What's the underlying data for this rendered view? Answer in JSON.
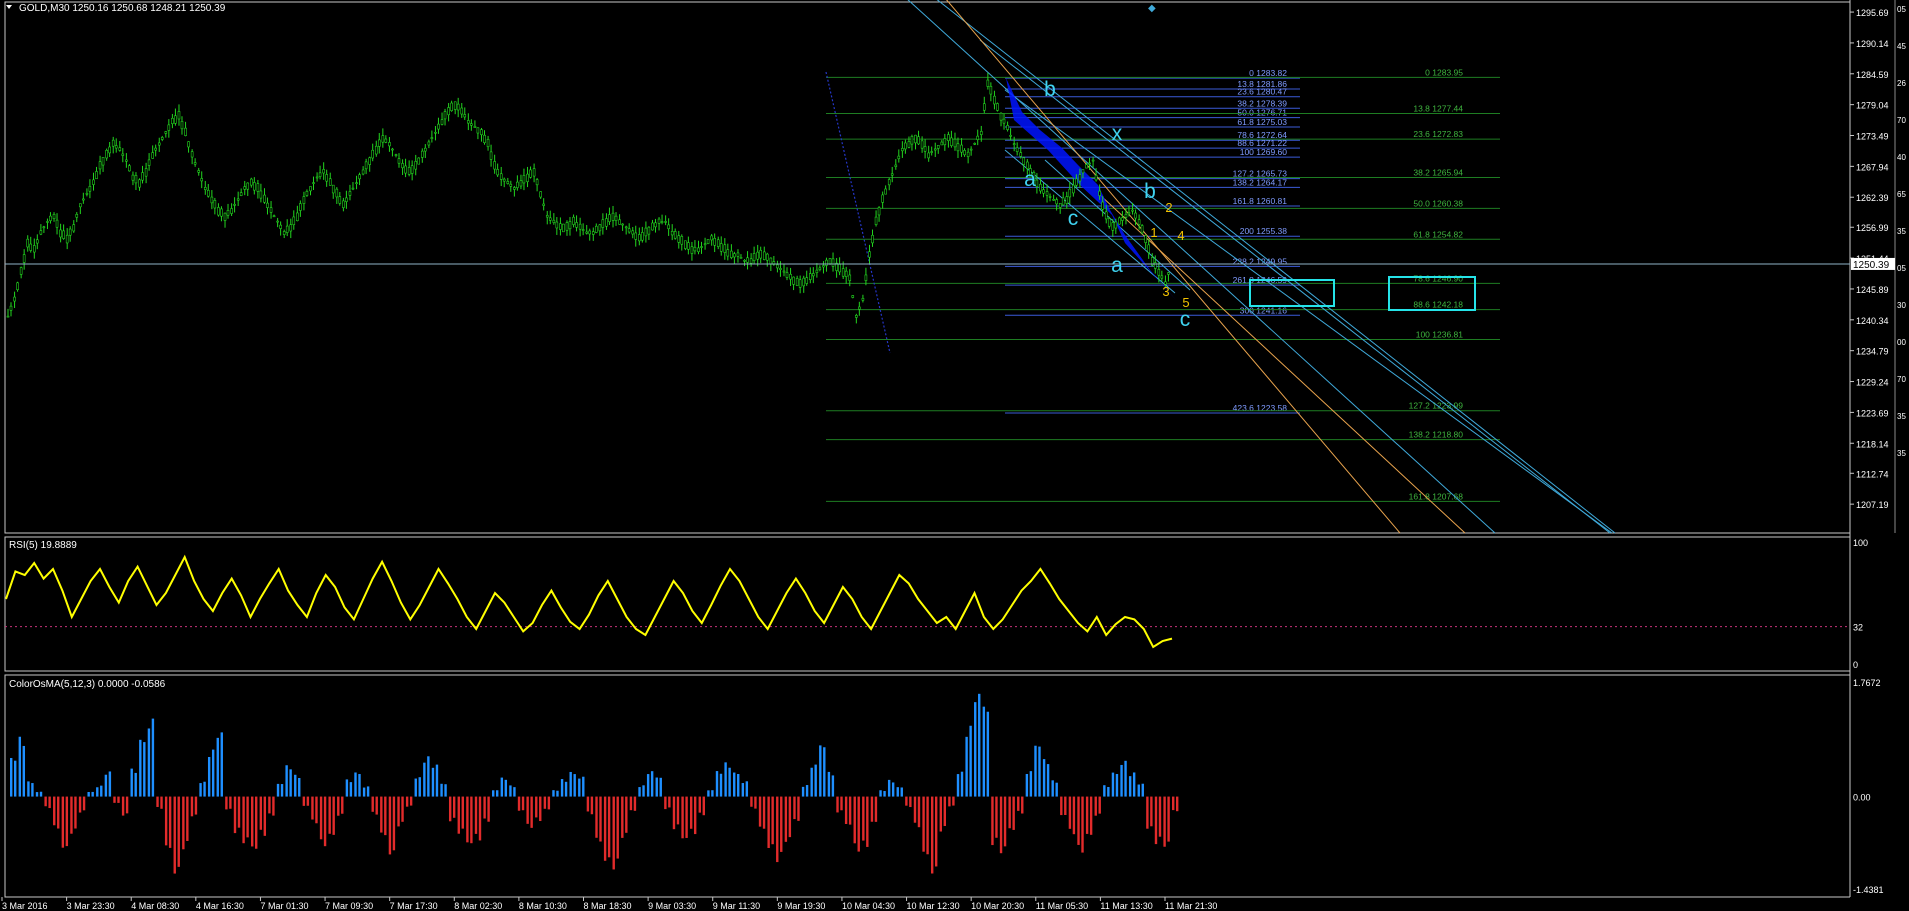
{
  "main": {
    "header": "GOLD,M30  1250.16 1250.68 1248.21 1250.39",
    "ylim": [
      1202.0,
      1297.5
    ],
    "yticks": [
      "1295.69",
      "1290.14",
      "1284.59",
      "1279.04",
      "1273.49",
      "1267.94",
      "1262.39",
      "1256.99",
      "1251.44",
      "1245.89",
      "1240.34",
      "1234.79",
      "1229.24",
      "1223.69",
      "1218.14",
      "1212.74",
      "1207.19"
    ],
    "current_price": "1250.39",
    "close_series": [
      1241,
      1244,
      1249,
      1254,
      1253,
      1256,
      1258,
      1259,
      1256,
      1255,
      1257,
      1261,
      1263,
      1265,
      1268,
      1270,
      1272,
      1271,
      1269,
      1266,
      1265,
      1267,
      1270,
      1272,
      1274,
      1276,
      1277,
      1274,
      1270,
      1267,
      1264,
      1262,
      1260,
      1259,
      1260,
      1262,
      1264,
      1265,
      1264,
      1262,
      1260,
      1258,
      1256,
      1257,
      1259,
      1262,
      1264,
      1266,
      1267,
      1265,
      1263,
      1261,
      1263,
      1265,
      1267,
      1269,
      1271,
      1273,
      1272,
      1270,
      1268,
      1267,
      1268,
      1270,
      1272,
      1274,
      1276,
      1278,
      1279,
      1278,
      1276,
      1275,
      1274,
      1272,
      1268,
      1266,
      1265,
      1264,
      1265,
      1266,
      1267,
      1263,
      1259,
      1258,
      1257,
      1257,
      1258,
      1257,
      1256,
      1256,
      1257,
      1258,
      1259,
      1258,
      1257,
      1256,
      1255,
      1256,
      1257,
      1258,
      1258,
      1256,
      1255,
      1254,
      1253,
      1253,
      1254,
      1255,
      1254,
      1253,
      1252,
      1252,
      1251,
      1251,
      1252,
      1252,
      1251,
      1250,
      1249,
      1248,
      1247,
      1247,
      1248,
      1249,
      1250,
      1251,
      1250,
      1249,
      1248,
      1241,
      1244,
      1252,
      1258,
      1262,
      1265,
      1268,
      1271,
      1272,
      1273,
      1272,
      1270,
      1271,
      1272,
      1273,
      1272,
      1271,
      1270,
      1272,
      1274,
      1283,
      1280,
      1277,
      1275,
      1272,
      1270,
      1268,
      1266,
      1264,
      1263,
      1262,
      1261,
      1262,
      1264,
      1266,
      1268,
      1269,
      1263,
      1259,
      1257,
      1258,
      1259,
      1260,
      1258,
      1255,
      1251,
      1249,
      1247,
      1250.39
    ],
    "fib_left": [
      {
        "label": "0 1283.82",
        "price": 1283.82
      },
      {
        "label": "13.8 1281.86",
        "price": 1281.86
      },
      {
        "label": "23.6 1280.47",
        "price": 1280.47
      },
      {
        "label": "38.2 1278.39",
        "price": 1278.39
      },
      {
        "label": "50.0 1276.71",
        "price": 1276.71
      },
      {
        "label": "61.8 1275.03",
        "price": 1275.03
      },
      {
        "label": "78.6 1272.64",
        "price": 1272.64
      },
      {
        "label": "88.6 1271.22",
        "price": 1271.22
      },
      {
        "label": "100 1269.60",
        "price": 1269.6
      },
      {
        "label": "127.2 1265.73",
        "price": 1265.73
      },
      {
        "label": "138.2 1264.17",
        "price": 1264.17
      },
      {
        "label": "161.8 1260.81",
        "price": 1260.81
      },
      {
        "label": "200 1255.38",
        "price": 1255.38
      },
      {
        "label": "238.2 1249.95",
        "price": 1249.95
      },
      {
        "label": "261.8 1246.59",
        "price": 1246.59
      },
      {
        "label": "300 1241.16",
        "price": 1241.16
      },
      {
        "label": "423.6 1223.58",
        "price": 1223.58
      }
    ],
    "fib_right": [
      {
        "label": "0 1283.95",
        "price": 1283.95
      },
      {
        "label": "13.8 1277.44",
        "price": 1277.44
      },
      {
        "label": "23.6 1272.83",
        "price": 1272.83
      },
      {
        "label": "38.2 1265.94",
        "price": 1265.94
      },
      {
        "label": "50.0 1260.38",
        "price": 1260.38
      },
      {
        "label": "61.8 1254.82",
        "price": 1254.82
      },
      {
        "label": "78.6 1246.90",
        "price": 1246.9
      },
      {
        "label": "88.6 1242.18",
        "price": 1242.18
      },
      {
        "label": "100 1236.81",
        "price": 1236.81
      },
      {
        "label": "127.2 1223.99",
        "price": 1223.99
      },
      {
        "label": "138.2 1218.80",
        "price": 1218.8
      },
      {
        "label": "161.8 1207.68",
        "price": 1207.68
      }
    ],
    "wave_labels": [
      {
        "text": "b",
        "color": "#3fd3f0"
      },
      {
        "text": "x",
        "color": "#3fd3f0"
      },
      {
        "text": "a",
        "color": "#3fd3f0"
      },
      {
        "text": "c",
        "color": "#3fd3f0"
      },
      {
        "text": "b",
        "color": "#3fd3f0"
      },
      {
        "text": "a",
        "color": "#3fd3f0"
      },
      {
        "text": "c",
        "color": "#3fd3f0"
      },
      {
        "text": "1",
        "color": "#f2c200"
      },
      {
        "text": "2",
        "color": "#f2c200"
      },
      {
        "text": "3",
        "color": "#f2c200"
      },
      {
        "text": "4",
        "color": "#f2c200"
      },
      {
        "text": "5",
        "color": "#f2c200"
      }
    ],
    "target_boxes": [
      {
        "price": 1246.59,
        "color": "#25e3e8"
      },
      {
        "price": 1246.9,
        "color": "#25e3e8"
      }
    ],
    "right_edge_marks": [
      "05",
      "45",
      "26",
      "70",
      "40",
      "65",
      "35",
      "05",
      "30",
      "00",
      "70",
      "35",
      "35"
    ]
  },
  "rsi": {
    "header": "RSI(5) 19.8889",
    "levels": [
      "100",
      "32",
      "0"
    ],
    "level_line": 32,
    "color": "#ffff00",
    "values": [
      55,
      78,
      75,
      85,
      72,
      80,
      62,
      40,
      55,
      70,
      80,
      65,
      52,
      70,
      82,
      66,
      50,
      60,
      75,
      90,
      70,
      55,
      45,
      60,
      72,
      58,
      40,
      55,
      68,
      80,
      62,
      50,
      40,
      60,
      75,
      65,
      48,
      38,
      55,
      72,
      86,
      70,
      52,
      38,
      50,
      65,
      80,
      68,
      55,
      40,
      30,
      45,
      60,
      52,
      40,
      28,
      35,
      50,
      62,
      48,
      36,
      30,
      42,
      58,
      70,
      55,
      40,
      30,
      25,
      40,
      55,
      70,
      60,
      45,
      35,
      50,
      66,
      80,
      70,
      55,
      40,
      30,
      45,
      60,
      72,
      60,
      45,
      35,
      50,
      65,
      55,
      40,
      30,
      45,
      60,
      75,
      68,
      55,
      45,
      35,
      40,
      30,
      45,
      60,
      40,
      30,
      38,
      50,
      62,
      70,
      80,
      68,
      55,
      45,
      35,
      28,
      40,
      25,
      34,
      40,
      38,
      30,
      15,
      20,
      22
    ]
  },
  "osma": {
    "header": "ColorOsMA(5,12,3) 0.0000 -0.0586",
    "levels": [
      "1.7672",
      "0.00",
      "-1.4381"
    ],
    "ylim": [
      -1.4381,
      1.7672
    ],
    "up_color": "#1e8fff",
    "down_color": "#e22b2b",
    "values": [
      0.6,
      1.0,
      0.3,
      0.1,
      -0.2,
      -0.5,
      -0.8,
      -0.6,
      -0.3,
      0.1,
      0.2,
      0.4,
      -0.1,
      -0.3,
      0.5,
      1.2,
      1.5,
      -0.2,
      -0.8,
      -1.2,
      -0.9,
      -0.4,
      0.3,
      0.8,
      1.0,
      -0.2,
      -0.6,
      -0.9,
      -1.1,
      -0.7,
      -0.3,
      0.2,
      0.5,
      0.4,
      -0.2,
      -0.5,
      -0.8,
      -0.6,
      -0.3,
      0.3,
      0.5,
      0.2,
      -0.3,
      -0.6,
      -0.9,
      -0.5,
      -0.2,
      0.4,
      0.7,
      0.5,
      0.2,
      -0.4,
      -0.7,
      -1.0,
      -0.8,
      -0.4,
      0.1,
      0.3,
      0.2,
      -0.3,
      -0.6,
      -0.4,
      -0.2,
      0.1,
      0.3,
      0.5,
      0.4,
      -0.3,
      -0.7,
      -1.0,
      -1.2,
      -0.8,
      -0.3,
      0.2,
      0.4,
      0.3,
      -0.2,
      -0.6,
      -0.9,
      -0.7,
      -0.3,
      0.1,
      0.4,
      0.6,
      0.5,
      0.3,
      -0.2,
      -0.5,
      -0.8,
      -1.1,
      -0.9,
      -0.5,
      0.2,
      0.5,
      0.8,
      0.4,
      -0.3,
      -0.6,
      -1.0,
      -0.8,
      -0.4,
      0.1,
      0.3,
      0.2,
      -0.2,
      -0.5,
      -0.9,
      -1.2,
      -0.6,
      -0.2,
      0.5,
      1.2,
      1.6,
      1.4,
      -0.8,
      -1.1,
      -0.7,
      -0.3,
      0.4,
      0.8,
      0.6,
      0.3,
      -0.4,
      -0.7,
      -0.9,
      -0.6,
      -0.3,
      0.2,
      0.5,
      0.7,
      0.4,
      0.2,
      -0.5,
      -0.8,
      -1.0,
      -0.3
    ]
  },
  "x_axis": [
    "3 Mar 2016",
    "3 Mar 23:30",
    "4 Mar 08:30",
    "4 Mar 16:30",
    "7 Mar 01:30",
    "7 Mar 09:30",
    "7 Mar 17:30",
    "8 Mar 02:30",
    "8 Mar 10:30",
    "8 Mar 18:30",
    "9 Mar 03:30",
    "9 Mar 11:30",
    "9 Mar 19:30",
    "10 Mar 04:30",
    "10 Mar 12:30",
    "10 Mar 20:30",
    "11 Mar 05:30",
    "11 Mar 13:30",
    "11 Mar 21:30"
  ]
}
